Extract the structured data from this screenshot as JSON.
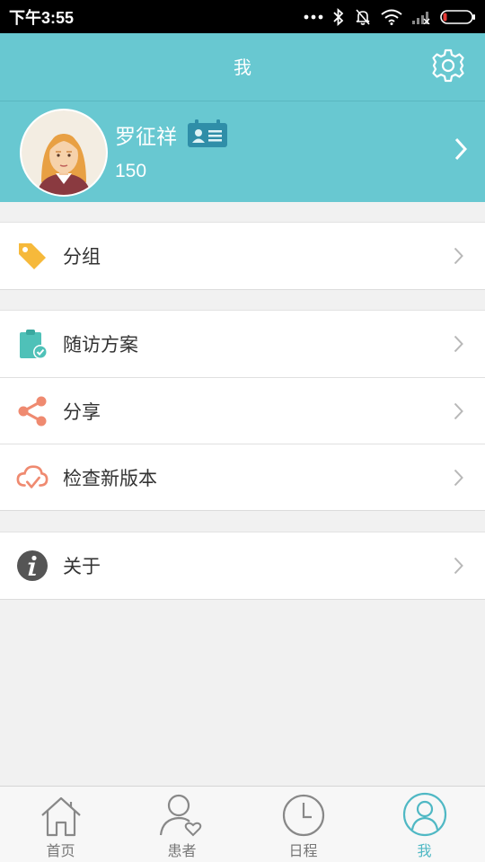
{
  "status_bar": {
    "time": "下午3:55"
  },
  "header": {
    "title": "我"
  },
  "profile": {
    "name": "罗征祥",
    "number": "150"
  },
  "menu_groups": [
    {
      "items": [
        {
          "label": "分组",
          "icon": "tag-icon"
        }
      ]
    },
    {
      "items": [
        {
          "label": "随访方案",
          "icon": "clipboard-check-icon"
        },
        {
          "label": "分享",
          "icon": "share-icon"
        },
        {
          "label": "检查新版本",
          "icon": "cloud-check-icon"
        }
      ]
    },
    {
      "items": [
        {
          "label": "关于",
          "icon": "info-icon"
        }
      ]
    }
  ],
  "tabbar": {
    "tabs": [
      {
        "label": "首页",
        "icon": "home-icon",
        "active": false
      },
      {
        "label": "患者",
        "icon": "patient-icon",
        "active": false
      },
      {
        "label": "日程",
        "icon": "clock-icon",
        "active": false
      },
      {
        "label": "我",
        "icon": "user-icon",
        "active": true
      }
    ]
  },
  "colors": {
    "accent": "#68c8d1",
    "active_tab": "#4fb8c4",
    "tag": "#f6b93b",
    "clipboard": "#4fc1b8",
    "share": "#ef8a70",
    "cloud": "#ef8a70",
    "info": "#555555"
  }
}
